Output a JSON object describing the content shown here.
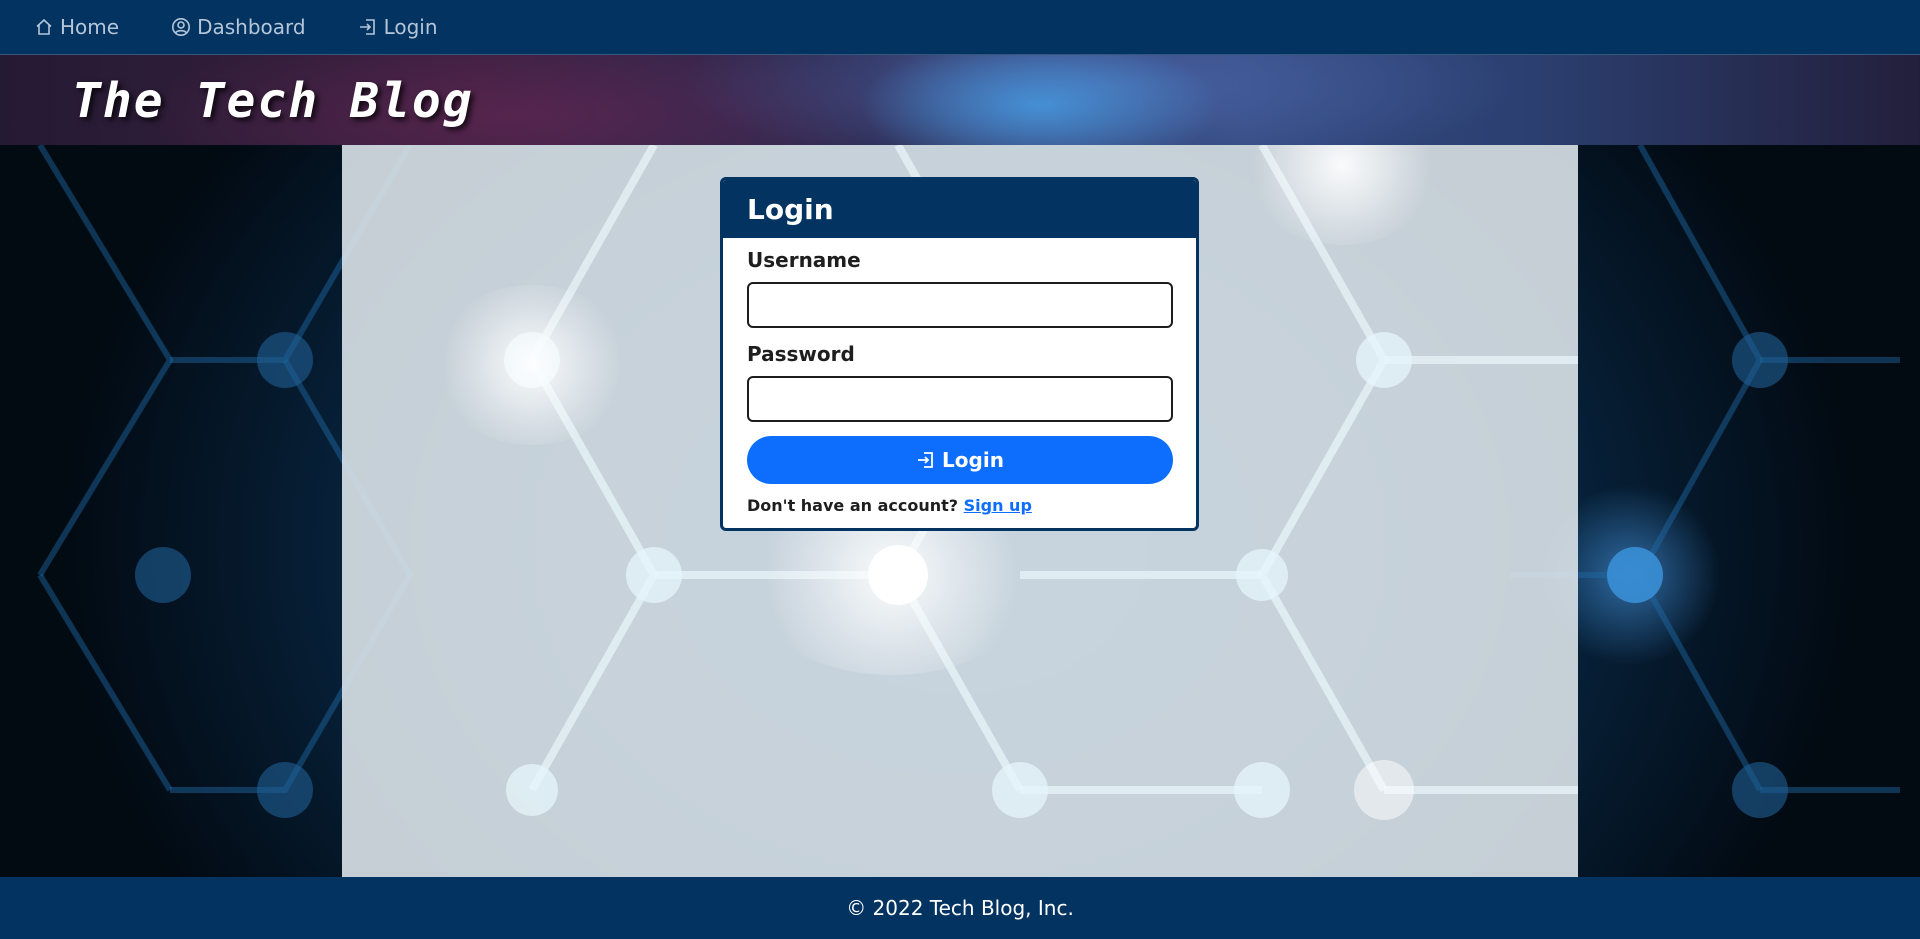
{
  "nav": {
    "items": [
      {
        "label": "Home",
        "icon": "house-icon"
      },
      {
        "label": "Dashboard",
        "icon": "user-circle-icon"
      },
      {
        "label": "Login",
        "icon": "login-icon"
      }
    ]
  },
  "banner": {
    "title": "The Tech Blog"
  },
  "login": {
    "title": "Login",
    "username_label": "Username",
    "username_value": "",
    "password_label": "Password",
    "password_value": "",
    "button_label": "Login",
    "signup_prompt": "Don't have an account?",
    "signup_link": "Sign up"
  },
  "footer": {
    "text": "© 2022 Tech Blog, Inc."
  },
  "colors": {
    "navy": "#023361",
    "primary_blue": "#0d6efd",
    "nav_text": "#b5c6d8"
  }
}
